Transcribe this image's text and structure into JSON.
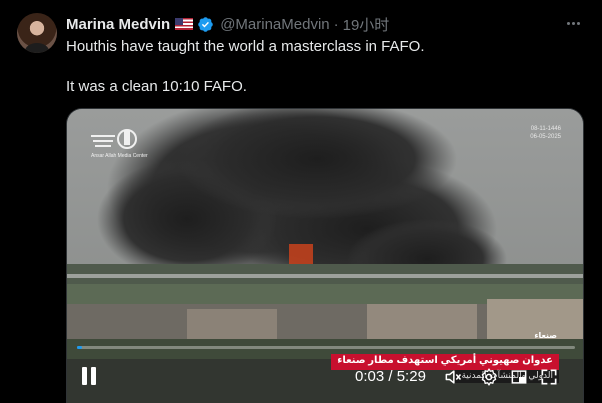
{
  "author": {
    "name": "Marina Medvin",
    "flag_icon": "us-flag-icon",
    "verified_icon": "verified-badge-icon",
    "handle": "@MarinaMedvin",
    "separator": "·",
    "time": "19小时"
  },
  "tweet": {
    "line1": "Houthis have taught the world a masterclass in FAFO.",
    "line2": "It was a clean 10:10 FAFO."
  },
  "video": {
    "logo_text": "Ansar Allah Media Center",
    "stamp_line1": "08-11-1446",
    "stamp_line2": "06-05-2025",
    "chyron_small": "صنعاء",
    "chyron_main": "عدوان صهيوني أمريكي استهدف مطار صنعاء",
    "chyron_sub": "الدولي والمنشآت المدنية",
    "progress": 0.01,
    "current_time": "0:03",
    "duration": "5:29",
    "time_separator": " / ",
    "icons": [
      "pause-icon",
      "volume-muted-icon",
      "settings-icon",
      "fullscreen-icon"
    ],
    "accent": "#1d9bf0"
  }
}
